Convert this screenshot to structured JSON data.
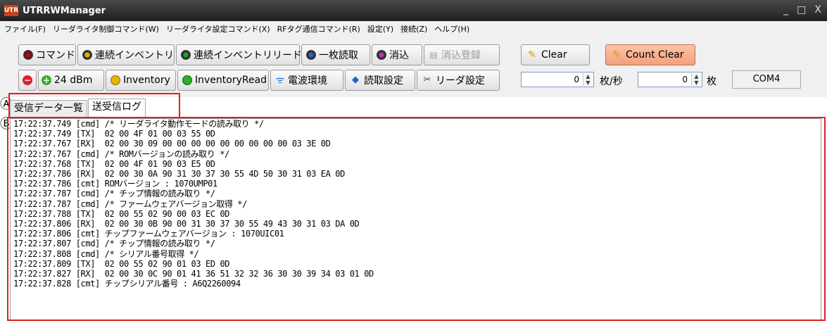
{
  "window": {
    "logo": "UTR",
    "title": "UTRRWManager",
    "minimize": "_",
    "maximize": "□",
    "close": "X"
  },
  "menu": [
    "ファイル(F)",
    "リーダライタ制御コマンド(W)",
    "リーダライタ設定コマンド(X)",
    "RFタグ通信コマンド(R)",
    "設定(Y)",
    "接続(Z)",
    "ヘルプ(H)"
  ],
  "toolbar1": {
    "command": "コマンド",
    "continuous_inventory": "連続インベントリ",
    "continuous_inventory_read": "連続インベントリリード",
    "single_read": "一枚読取",
    "erase": "消込",
    "erase_register": "消込登録"
  },
  "toolbar2": {
    "power": "24 dBm",
    "inventory": "Inventory",
    "inventory_read": "InventoryRead",
    "radio_env": "電波環境",
    "read_settings": "読取設定",
    "reader_settings": "リーダ設定"
  },
  "counter": {
    "clear": "Clear",
    "count_clear": "Count Clear",
    "rate_value": "0",
    "rate_unit": "枚/秒",
    "count_value": "0",
    "count_unit": "枚",
    "port": "COM4"
  },
  "markers": {
    "a": "Ⓐ",
    "b": "Ⓑ"
  },
  "tabs": [
    "受信データ一覧",
    "送受信ログ"
  ],
  "log": [
    "17:22:37.749 [cmd] /* リーダライタ動作モードの読み取り */",
    "17:22:37.749 [TX]  02 00 4F 01 00 03 55 0D",
    "17:22:37.767 [RX]  02 00 30 09 00 00 00 00 00 00 00 00 00 03 3E 0D",
    "17:22:37.767 [cmd] /* ROMバージョンの読み取り */",
    "17:22:37.768 [TX]  02 00 4F 01 90 03 E5 0D",
    "17:22:37.786 [RX]  02 00 30 0A 90 31 30 37 30 55 4D 50 30 31 03 EA 0D",
    "17:22:37.786 [cmt] ROMバージョン : 1070UMP01",
    "17:22:37.787 [cmd] /* チップ情報の読み取り */",
    "17:22:37.787 [cmd] /* ファームウェアバージョン取得 */",
    "17:22:37.788 [TX]  02 00 55 02 90 00 03 EC 0D",
    "17:22:37.806 [RX]  02 00 30 0B 90 00 31 30 37 30 55 49 43 30 31 03 DA 0D",
    "17:22:37.806 [cmt] チップファームウェアバージョン : 1070UIC01",
    "17:22:37.807 [cmd] /* チップ情報の読み取り */",
    "17:22:37.808 [cmd] /* シリアル番号取得 */",
    "17:22:37.809 [TX]  02 00 55 02 90 01 03 ED 0D",
    "17:22:37.827 [RX]  02 00 30 0C 90 01 41 36 51 32 32 36 30 30 39 34 03 01 0D",
    "17:22:37.828 [cmt] チップシリアル番号 : A6Q2260094"
  ]
}
